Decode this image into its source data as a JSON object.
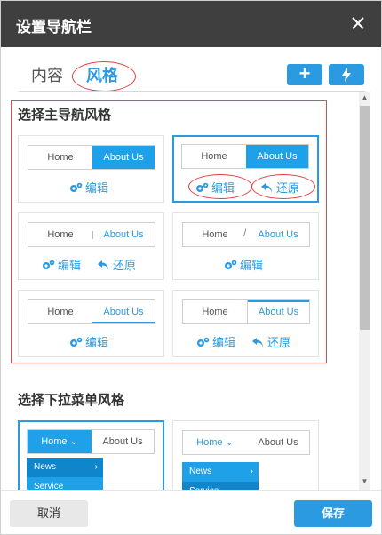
{
  "dialog": {
    "title": "设置导航栏",
    "close_icon": "close-icon"
  },
  "tabs": [
    {
      "label": "内容",
      "active": false
    },
    {
      "label": "风格",
      "active": true
    }
  ],
  "toolbar": {
    "add_icon": "plus-icon",
    "quick_icon": "lightning-icon",
    "add_glyph": "+",
    "accent_color": "#2b9ae0"
  },
  "main_nav_section": {
    "title": "选择主导航风格",
    "styles": [
      {
        "left": "Home",
        "right": "About Us",
        "actions": [
          "编辑"
        ],
        "selected": false
      },
      {
        "left": "Home",
        "right": "About Us",
        "actions": [
          "编辑",
          "还原"
        ],
        "selected": true
      },
      {
        "left": "Home",
        "right": "About Us",
        "actions": [
          "编辑",
          "还原"
        ],
        "selected": false
      },
      {
        "left": "Home",
        "right": "About Us",
        "separator": "/",
        "actions": [
          "编辑"
        ],
        "selected": false
      },
      {
        "left": "Home",
        "right": "About Us",
        "actions": [
          "编辑"
        ],
        "selected": false
      },
      {
        "left": "Home",
        "right": "About Us",
        "actions": [
          "编辑",
          "还原"
        ],
        "selected": false
      }
    ]
  },
  "dropdown_section": {
    "title": "选择下拉菜单风格",
    "styles": [
      {
        "left": "Home",
        "right": "About Us",
        "items": [
          "News",
          "Service"
        ],
        "selected": true
      },
      {
        "left": "Home",
        "right": "About Us",
        "items": [
          "News",
          "Service"
        ],
        "selected": false
      }
    ]
  },
  "footer": {
    "cancel_label": "取消",
    "save_label": "保存"
  }
}
